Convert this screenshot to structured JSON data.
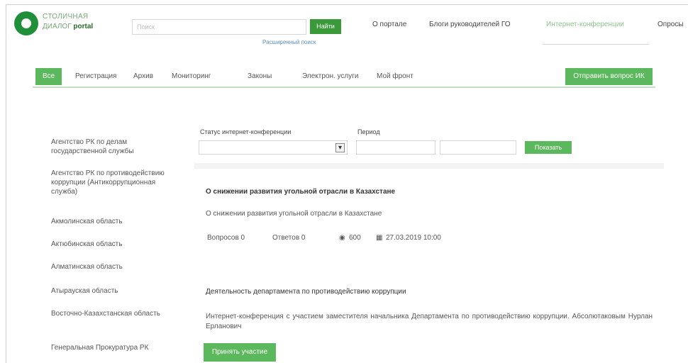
{
  "header": {
    "logo_line1": "СТОЛИЧНАЯ",
    "logo_line2": "ДИАЛОГ",
    "logo_line2_bold": "portal",
    "search_placeholder": "Поиск",
    "search_button": "Найти",
    "advanced_search": "Расширенный поиск",
    "links": [
      "О портале",
      "Блоги руководителей ГО",
      "Интернет-конференции",
      "Опросы"
    ]
  },
  "nav": {
    "items": [
      "Все",
      "Регистрация",
      "Архив",
      "Мониторинг",
      "Законы",
      "Электрон. услуги",
      "Мой фронт"
    ],
    "ask_button": "Отправить вопрос ИК"
  },
  "sidebar": {
    "items": [
      "Агентство РК по делам государственной службы",
      "Агентство РК по противодействию коррупции (Антикоррупционная служба)",
      "Акмолинская область",
      "Актюбинская область",
      "Алматинская область",
      "Атырауская область",
      "Восточно-Казахстанская область",
      "Генеральная Прокуратура РК"
    ]
  },
  "filters": {
    "status_label": "Статус интернет-конференции",
    "period_label": "Период",
    "apply_button": "Показать"
  },
  "conference1": {
    "title": "О снижении развития угольной отрасли в Казахстане",
    "subtitle": "О снижении развития угольной отрасли в Казахстане",
    "questions": "Вопросов 0",
    "answers": "Ответов 0",
    "views": "600",
    "date": "27.03.2019 10:00"
  },
  "conference2": {
    "title": "Деятельность департамента по противодействию коррупции",
    "description": "Интернет-конференция с участием заместителя начальника Департамента по противодействию коррупции. Абсолютаковым Нурлан Ерланович",
    "participate_button": "Принять участие"
  }
}
